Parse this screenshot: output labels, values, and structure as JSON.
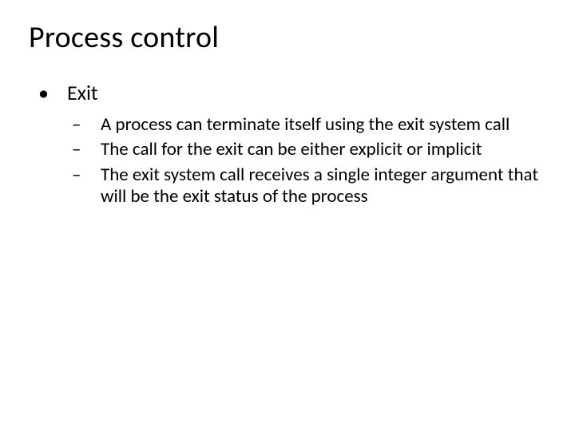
{
  "title": "Process control",
  "bullets": [
    {
      "label": "Exit",
      "sub": [
        "A process can terminate itself using the exit system call",
        "The call for the exit can be either explicit or implicit",
        "The exit system call receives a single integer argument that will be the exit status of the process"
      ]
    }
  ],
  "glyphs": {
    "bullet": "•",
    "dash": "–"
  }
}
